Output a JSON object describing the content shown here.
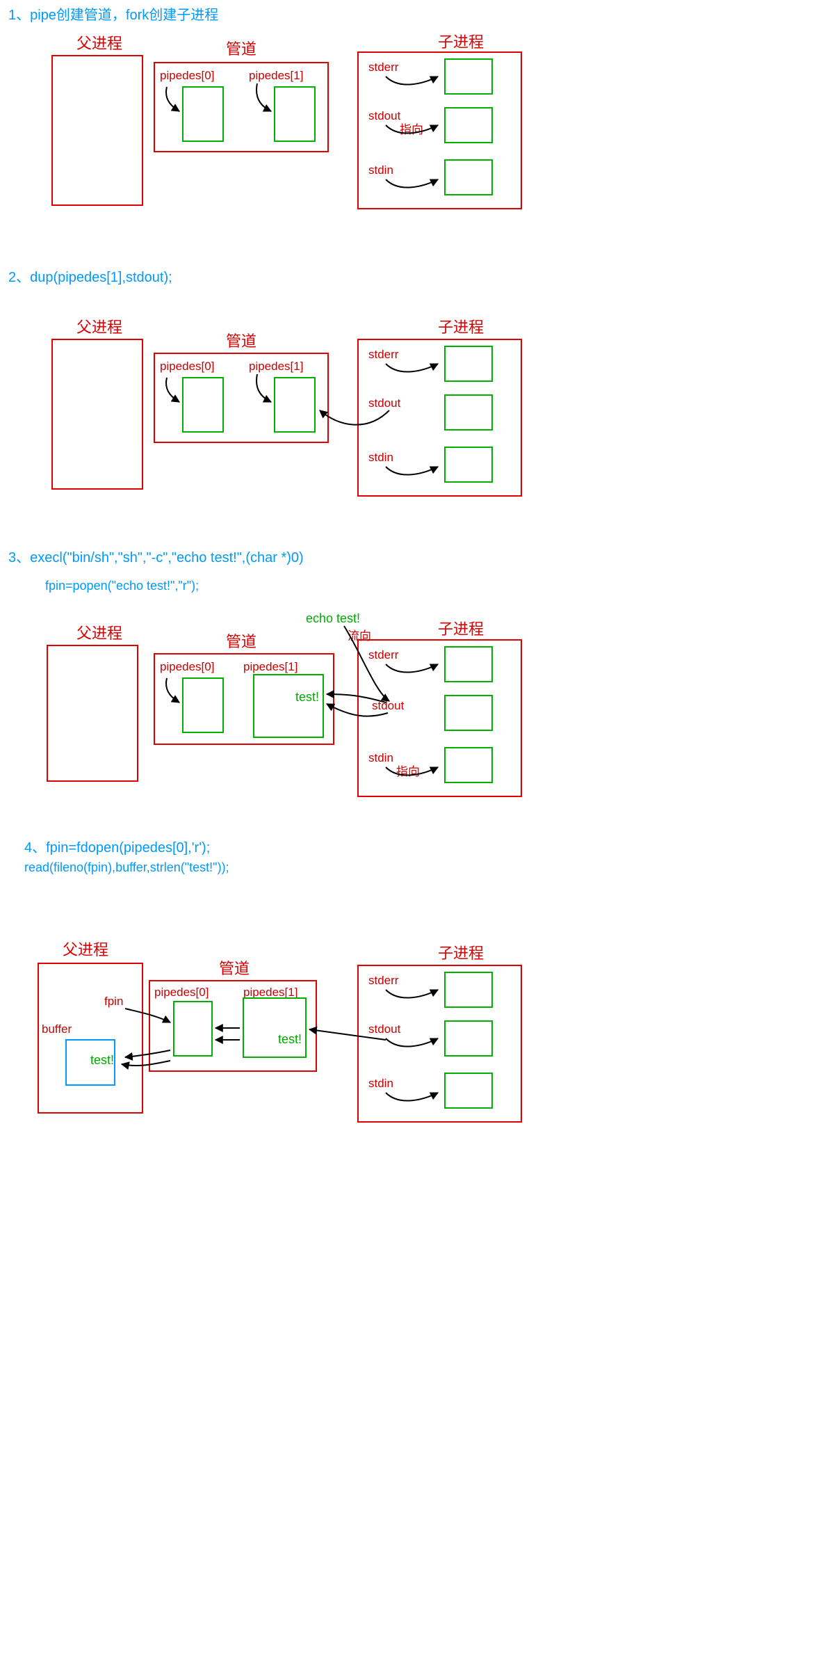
{
  "steps": {
    "s1": {
      "title": "1、pipe创建管道，fork创建子进程"
    },
    "s2": {
      "title": "2、dup(pipedes[1],stdout);"
    },
    "s3": {
      "title": "3、execl(\"bin/sh\",\"sh\",\"-c\",\"echo test!\",(char *)0)",
      "sub": "fpin=popen(\"echo test!\",\"r\");"
    },
    "s4": {
      "title": "4、fpin=fdopen(pipedes[0],'r');",
      "sub": "read(fileno(fpin),buffer,strlen(\"test!\"));"
    }
  },
  "labels": {
    "parent": "父进程",
    "pipe": "管道",
    "child": "子进程",
    "pipedes0": "pipedes[0]",
    "pipedes1": "pipedes[1]",
    "stderr": "stderr",
    "stdout": "stdout",
    "stdin": "stdin",
    "point_to": "指向",
    "flow_to": "流向",
    "echo": "echo test!",
    "test": "test!",
    "fpin": "fpin",
    "buffer": "buffer"
  }
}
